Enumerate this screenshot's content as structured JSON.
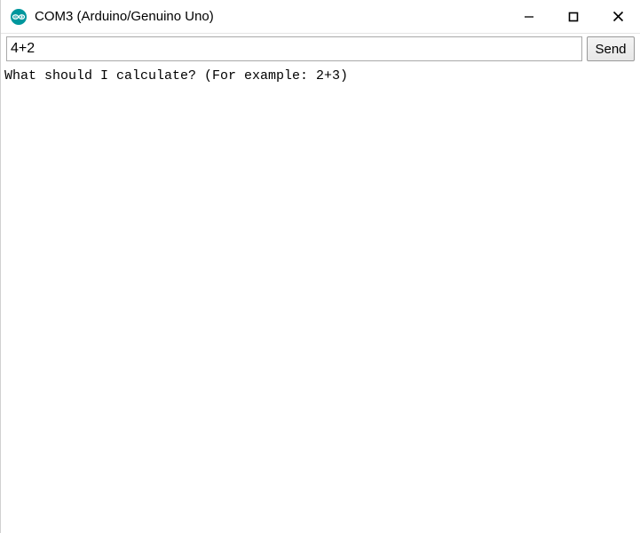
{
  "titlebar": {
    "title": "COM3 (Arduino/Genuino Uno)"
  },
  "input": {
    "value": "4+2"
  },
  "buttons": {
    "send": "Send"
  },
  "output": {
    "text": "What should I calculate? (For example: 2+3)"
  }
}
